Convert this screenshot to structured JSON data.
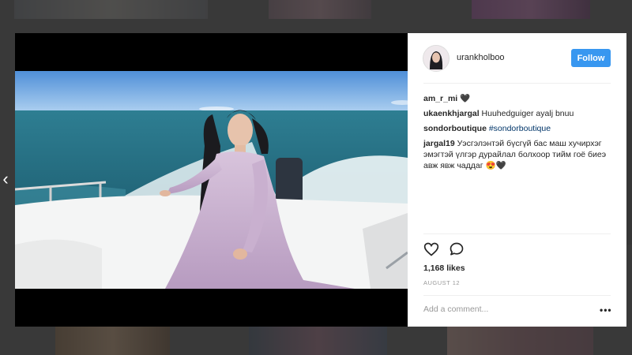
{
  "post": {
    "username": "urankholboo",
    "follow_label": "Follow",
    "comments": [
      {
        "user": "am_r_mi",
        "text": "🖤",
        "hashtag": ""
      },
      {
        "user": "ukaenkhjargal",
        "text": "Huuhedguiger ayalj bnuu",
        "hashtag": ""
      },
      {
        "user": "sondorboutique",
        "text": "",
        "hashtag": "#sondorboutique"
      },
      {
        "user": "jargal19",
        "text": "Уэсгэлэнтэй бүсгүй бас маш хучирхэг эмэгтэй үлгэр дурайлал болхоор тийм гоё биеэ авж явж чаддаг 😍🖤",
        "hashtag": ""
      }
    ],
    "likes": "1,168 likes",
    "date": "AUGUST 12",
    "add_comment_placeholder": "Add a comment...",
    "more_label": "•••"
  },
  "nav": {
    "prev_arrow": "‹"
  },
  "icons": {
    "like": "heart-icon",
    "comment": "comment-icon",
    "more": "more-options-icon"
  },
  "colors": {
    "accent": "#3897f0",
    "text": "#262626",
    "muted": "#999999",
    "hashtag": "#003569"
  }
}
